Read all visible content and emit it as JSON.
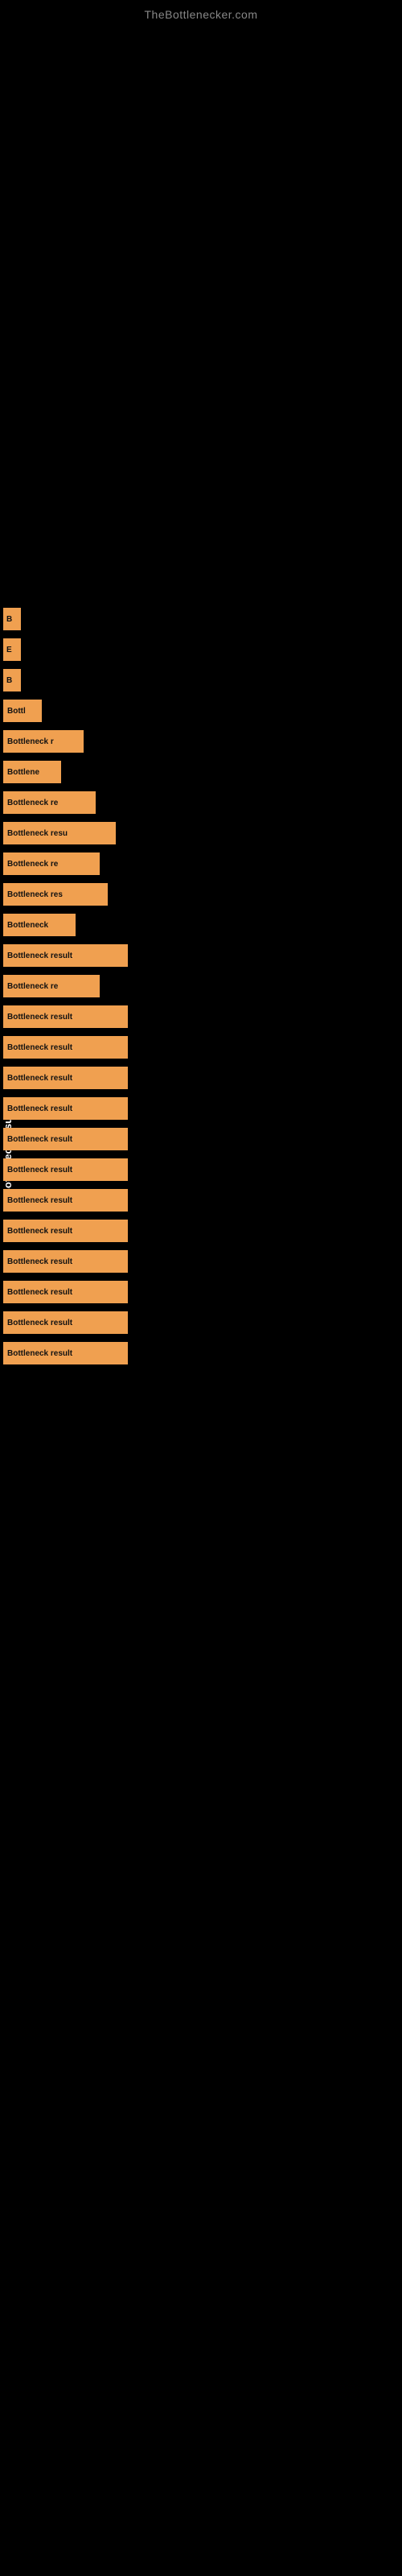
{
  "site": {
    "title": "TheBottlenecker.com"
  },
  "labels": {
    "vertical_axis": "Bottleneck result"
  },
  "results": [
    {
      "id": 1,
      "label": "B",
      "width": 22
    },
    {
      "id": 2,
      "label": "E",
      "width": 22
    },
    {
      "id": 3,
      "label": "B",
      "width": 22
    },
    {
      "id": 4,
      "label": "Bottl",
      "width": 48
    },
    {
      "id": 5,
      "label": "Bottleneck r",
      "width": 100
    },
    {
      "id": 6,
      "label": "Bottlene",
      "width": 72
    },
    {
      "id": 7,
      "label": "Bottleneck re",
      "width": 115
    },
    {
      "id": 8,
      "label": "Bottleneck resu",
      "width": 140
    },
    {
      "id": 9,
      "label": "Bottleneck re",
      "width": 120
    },
    {
      "id": 10,
      "label": "Bottleneck res",
      "width": 130
    },
    {
      "id": 11,
      "label": "Bottleneck",
      "width": 90
    },
    {
      "id": 12,
      "label": "Bottleneck result",
      "width": 155
    },
    {
      "id": 13,
      "label": "Bottleneck re",
      "width": 120
    },
    {
      "id": 14,
      "label": "Bottleneck result",
      "width": 155
    },
    {
      "id": 15,
      "label": "Bottleneck result",
      "width": 155
    },
    {
      "id": 16,
      "label": "Bottleneck result",
      "width": 155
    },
    {
      "id": 17,
      "label": "Bottleneck result",
      "width": 155
    },
    {
      "id": 18,
      "label": "Bottleneck result",
      "width": 155
    },
    {
      "id": 19,
      "label": "Bottleneck result",
      "width": 155
    },
    {
      "id": 20,
      "label": "Bottleneck result",
      "width": 155
    },
    {
      "id": 21,
      "label": "Bottleneck result",
      "width": 155
    },
    {
      "id": 22,
      "label": "Bottleneck result",
      "width": 155
    },
    {
      "id": 23,
      "label": "Bottleneck result",
      "width": 155
    },
    {
      "id": 24,
      "label": "Bottleneck result",
      "width": 155
    },
    {
      "id": 25,
      "label": "Bottleneck result",
      "width": 155
    }
  ]
}
